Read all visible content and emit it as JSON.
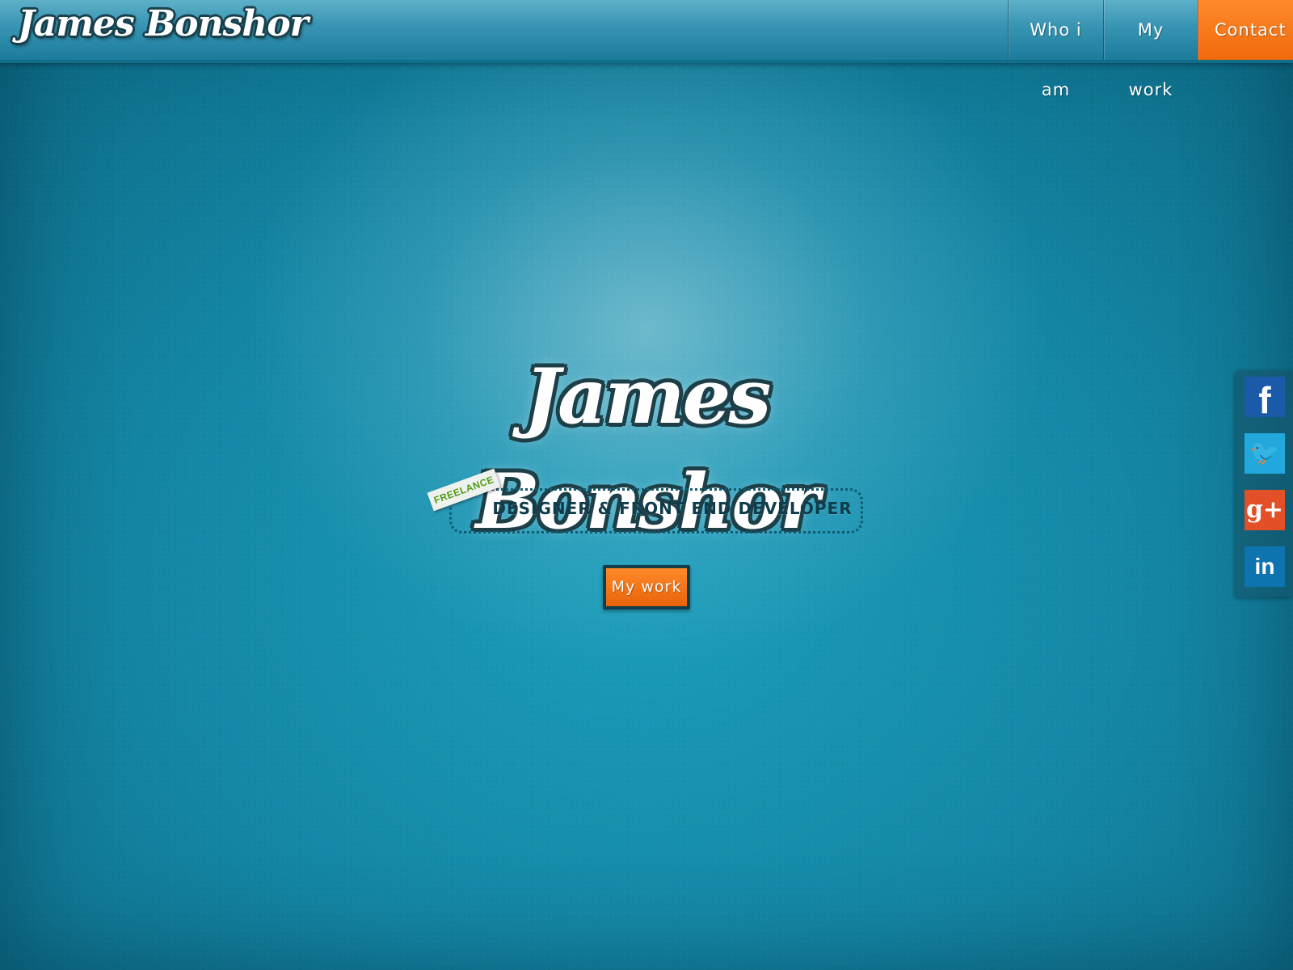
{
  "header": {
    "brand": "James Bonshor",
    "nav": [
      {
        "label": "Who i am"
      },
      {
        "label": "My work"
      },
      {
        "label": "Contact",
        "active": true
      }
    ]
  },
  "hero": {
    "logo_text": "James Bonshor",
    "badge": "FREELANCE",
    "tagline": "DESIGNER & FRONT END DEVELOPER",
    "cta_label": "My work"
  },
  "social": {
    "items": [
      {
        "network": "facebook",
        "icon": "facebook-icon",
        "glyph": "f"
      },
      {
        "network": "twitter",
        "icon": "twitter-icon",
        "glyph": "🐦"
      },
      {
        "network": "google-plus",
        "icon": "google-plus-icon",
        "glyph": "g+"
      },
      {
        "network": "linkedin",
        "icon": "linkedin-icon",
        "glyph": "in"
      }
    ]
  },
  "colors": {
    "accent_orange": "#f06a0c",
    "header_blue": "#3a96b4",
    "background_teal": "#1487a6",
    "logo_outline": "#1d3f48",
    "badge_green": "#4e9a12"
  }
}
